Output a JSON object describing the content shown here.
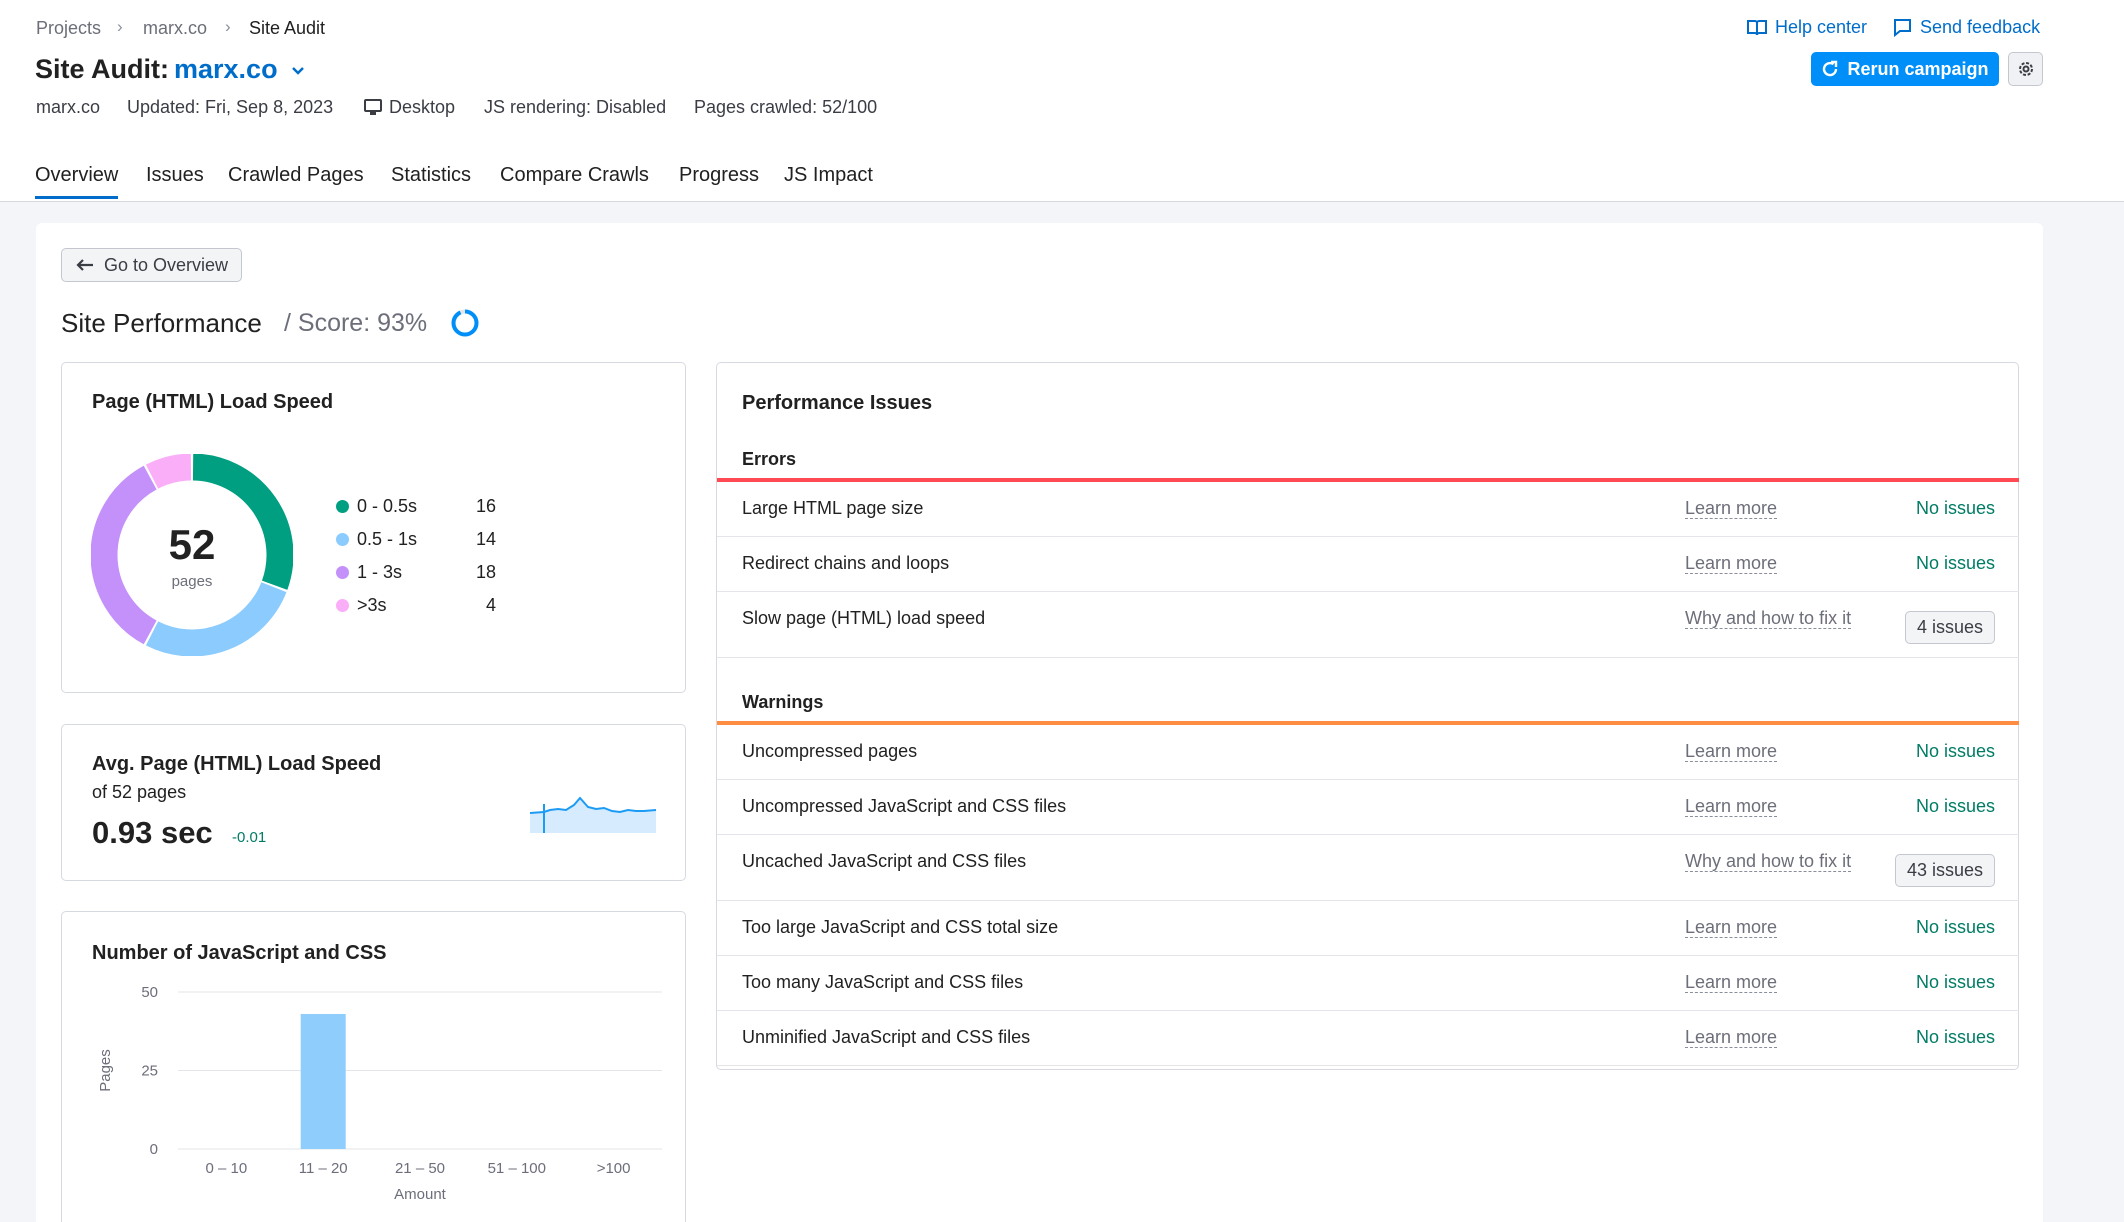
{
  "breadcrumb": [
    "Projects",
    "marx.co",
    "Site Audit"
  ],
  "header": {
    "label": "Site Audit:",
    "project": "marx.co"
  },
  "meta": {
    "domain": "marx.co",
    "updated": "Updated: Fri, Sep 8, 2023",
    "device": "Desktop",
    "js_rendering": "JS rendering: Disabled",
    "pages_crawled": "Pages crawled: 52/100"
  },
  "top_links": {
    "help": "Help center",
    "feedback": "Send feedback",
    "rerun": "Rerun campaign"
  },
  "tabs": [
    "Overview",
    "Issues",
    "Crawled Pages",
    "Statistics",
    "Compare Crawls",
    "Progress",
    "JS Impact"
  ],
  "back_button": "Go to Overview",
  "page": {
    "title": "Site Performance",
    "score": "/ Score: 93%",
    "score_value": 93
  },
  "load_speed": {
    "title": "Page (HTML) Load Speed",
    "total": "52",
    "total_label": "pages",
    "items": [
      {
        "label": "0 - 0.5s",
        "value": 16,
        "color": "#009f81"
      },
      {
        "label": "0.5 - 1s",
        "value": 14,
        "color": "#8bcbfd"
      },
      {
        "label": "1 - 3s",
        "value": 18,
        "color": "#c490f9"
      },
      {
        "label": ">3s",
        "value": 4,
        "color": "#fbaef8"
      }
    ]
  },
  "avg_speed": {
    "title": "Avg. Page (HTML) Load Speed",
    "subtitle": "of 52 pages",
    "value": "0.93 sec",
    "delta": "-0.01"
  },
  "js_css": {
    "title": "Number of JavaScript and CSS"
  },
  "chart_data": {
    "type": "bar",
    "categories": [
      "0 – 10",
      "11 – 20",
      "21 – 50",
      "51 – 100",
      ">100"
    ],
    "values": [
      0,
      43,
      0,
      0,
      0
    ],
    "xlabel": "Amount",
    "ylabel": "Pages",
    "yticks": [
      0,
      25,
      50
    ],
    "ylim": [
      0,
      50
    ],
    "color": "#8fcdfd"
  },
  "issues": {
    "title": "Performance Issues",
    "errors_label": "Errors",
    "warnings_label": "Warnings",
    "errors": [
      {
        "name": "Large HTML page size",
        "link": "Learn more",
        "status": "No issues"
      },
      {
        "name": "Redirect chains and loops",
        "link": "Learn more",
        "status": "No issues"
      },
      {
        "name": "Slow page (HTML) load speed",
        "link": "Why and how to fix it",
        "badge": "4 issues"
      }
    ],
    "warnings": [
      {
        "name": "Uncompressed pages",
        "link": "Learn more",
        "status": "No issues"
      },
      {
        "name": "Uncompressed JavaScript and CSS files",
        "link": "Learn more",
        "status": "No issues"
      },
      {
        "name": "Uncached JavaScript and CSS files",
        "link": "Why and how to fix it",
        "badge": "43 issues"
      },
      {
        "name": "Too large JavaScript and CSS total size",
        "link": "Learn more",
        "status": "No issues"
      },
      {
        "name": "Too many JavaScript and CSS files",
        "link": "Learn more",
        "status": "No issues"
      },
      {
        "name": "Unminified JavaScript and CSS files",
        "link": "Learn more",
        "status": "No issues"
      }
    ]
  }
}
